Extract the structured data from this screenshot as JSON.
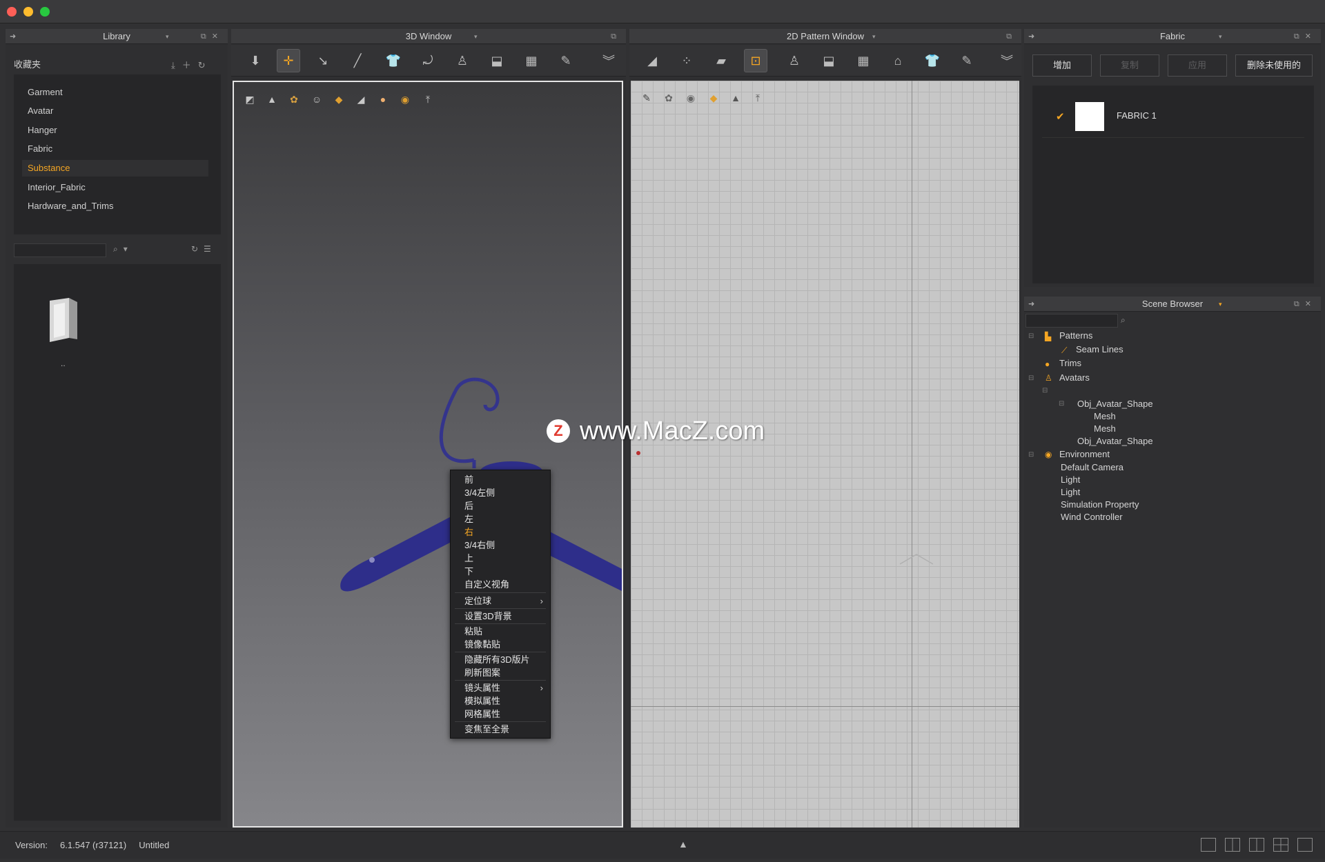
{
  "library": {
    "title": "Library",
    "favorites_label": "收藏夹",
    "items": [
      "Garment",
      "Avatar",
      "Hanger",
      "Fabric",
      "Substance",
      "Interior_Fabric",
      "Hardware_and_Trims"
    ],
    "selected_item": "Substance",
    "folder_label": ".."
  },
  "window3d": {
    "title": "3D Window"
  },
  "window2d": {
    "title": "2D Pattern Window"
  },
  "context_menu": {
    "items": [
      {
        "label": "前"
      },
      {
        "label": "3/4左侧"
      },
      {
        "label": "后"
      },
      {
        "label": "左"
      },
      {
        "label": "右",
        "highlight": true
      },
      {
        "label": "3/4右侧"
      },
      {
        "label": "上"
      },
      {
        "label": "下"
      },
      {
        "label": "自定义视角"
      },
      {
        "label": "定位球",
        "submenu": true
      },
      {
        "label": "设置3D背景"
      },
      {
        "label": "粘贴"
      },
      {
        "label": "镜像黏贴"
      },
      {
        "label": "隐藏所有3D版片"
      },
      {
        "label": "刷新图案"
      },
      {
        "label": "镜头属性",
        "submenu": true
      },
      {
        "label": "模拟属性"
      },
      {
        "label": "网格属性"
      },
      {
        "label": "变焦至全景"
      }
    ],
    "submenu_arrow": "›"
  },
  "fabric": {
    "title": "Fabric",
    "buttons": {
      "add": "增加",
      "copy": "复制",
      "apply": "应用",
      "delete_unused": "删除未使用的"
    },
    "items": [
      {
        "name": "FABRIC 1",
        "checked": true,
        "swatch_color": "#ffffff"
      }
    ]
  },
  "scene_browser": {
    "title": "Scene Browser",
    "tree": {
      "patterns": "Patterns",
      "seam_lines": "Seam Lines",
      "trims": "Trims",
      "avatars": "Avatars",
      "obj_avatar_shape_1": "Obj_Avatar_Shape",
      "mesh_1": "Mesh",
      "mesh_2": "Mesh",
      "obj_avatar_shape_2": "Obj_Avatar_Shape",
      "environment": "Environment",
      "default_camera": "Default Camera",
      "light_1": "Light",
      "light_2": "Light",
      "simulation_property": "Simulation Property",
      "wind_controller": "Wind Controller"
    }
  },
  "status_bar": {
    "version_label": "Version:",
    "version": "6.1.547 (r37121)",
    "file": "Untitled"
  },
  "watermark": {
    "badge": "Z",
    "text": "www.MacZ.com"
  },
  "colors": {
    "accent": "#f5a623",
    "hanger": "#2e2e8a",
    "viewport_border": "#e6e6e6"
  }
}
